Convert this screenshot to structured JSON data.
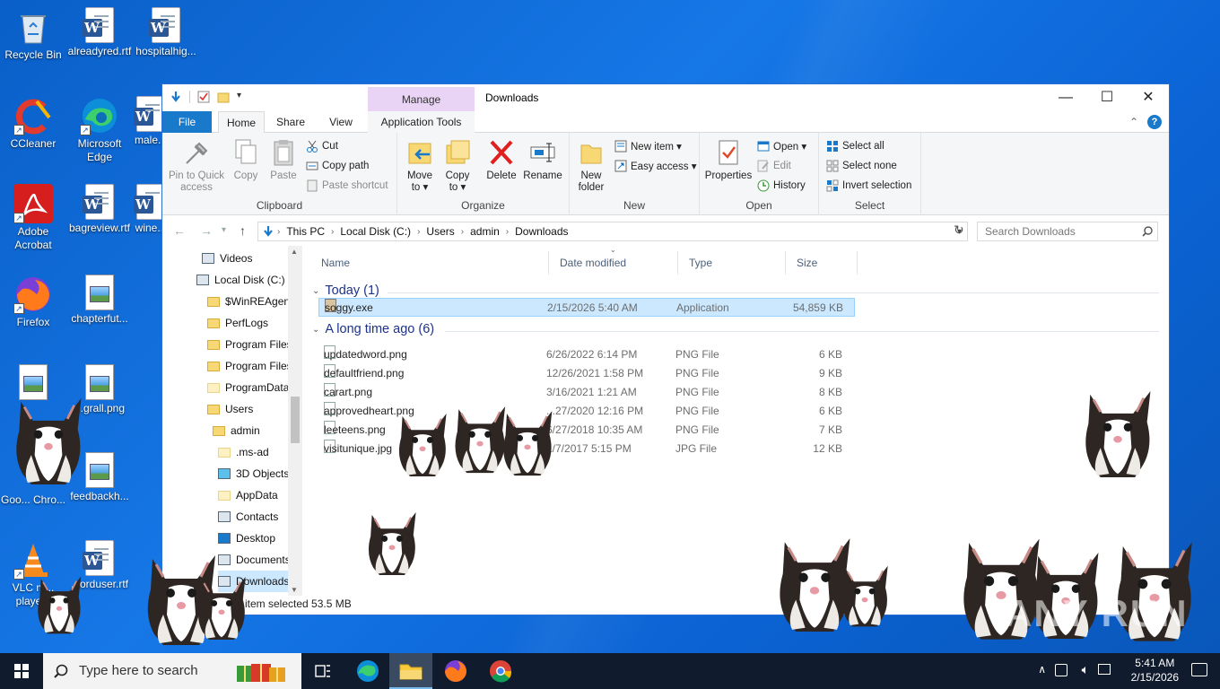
{
  "desktop": {
    "icons": [
      {
        "label": "Recycle Bin",
        "icon": "recycle-bin-icon"
      },
      {
        "label": "alreadyred.rtf",
        "icon": "word-document-icon"
      },
      {
        "label": "hospitalhig...",
        "icon": "word-document-icon"
      },
      {
        "label": "CCleaner",
        "icon": "ccleaner-icon"
      },
      {
        "label": "Microsoft Edge",
        "icon": "edge-icon"
      },
      {
        "label": "male...",
        "icon": "word-document-icon"
      },
      {
        "label": "Adobe Acrobat",
        "icon": "acrobat-icon"
      },
      {
        "label": "bagreview.rtf",
        "icon": "word-document-icon"
      },
      {
        "label": "wine...",
        "icon": "word-document-icon"
      },
      {
        "label": "Firefox",
        "icon": "firefox-icon"
      },
      {
        "label": "chapterfut...",
        "icon": "image-file-icon"
      },
      {
        "label": "...grall.png",
        "icon": "image-file-icon"
      },
      {
        "label": "Goo... Chro...",
        "icon": "chrome-icon"
      },
      {
        "label": "feedbackh...",
        "icon": "image-file-icon"
      },
      {
        "label": "VLC m... playe...",
        "icon": "vlc-icon"
      },
      {
        "label": "...orduser.rtf",
        "icon": "word-document-icon"
      }
    ]
  },
  "window": {
    "title": "Downloads",
    "manage_label": "Manage",
    "controls": {
      "minimize": "—",
      "maximize": "☐",
      "close": "✕"
    },
    "tabs": {
      "file": "File",
      "home": "Home",
      "share": "Share",
      "view": "View",
      "app_tools": "Application Tools"
    },
    "ribbon": {
      "clipboard": {
        "label": "Clipboard",
        "pin": "Pin to Quick access",
        "copy": "Copy",
        "paste": "Paste",
        "cut": "Cut",
        "copy_path": "Copy path",
        "paste_shortcut": "Paste shortcut"
      },
      "organize": {
        "label": "Organize",
        "move_to": "Move to ▾",
        "copy_to": "Copy to ▾",
        "delete": "Delete",
        "rename": "Rename"
      },
      "new": {
        "label": "New",
        "new_folder": "New folder",
        "new_item": "New item ▾",
        "easy_access": "Easy access ▾"
      },
      "open": {
        "label": "Open",
        "properties": "Properties",
        "open": "Open ▾",
        "edit": "Edit",
        "history": "History"
      },
      "select": {
        "label": "Select",
        "select_all": "Select all",
        "select_none": "Select none",
        "invert": "Invert selection"
      }
    },
    "address": {
      "crumbs": [
        "This PC",
        "Local Disk (C:)",
        "Users",
        "admin",
        "Downloads"
      ],
      "search_placeholder": "Search Downloads"
    },
    "nav": {
      "items": [
        {
          "label": "Videos",
          "indent": 1
        },
        {
          "label": "Local Disk (C:)",
          "indent": 0
        },
        {
          "label": "$WinREAgent",
          "indent": 2
        },
        {
          "label": "PerfLogs",
          "indent": 2
        },
        {
          "label": "Program Files",
          "indent": 2
        },
        {
          "label": "Program Files",
          "indent": 2
        },
        {
          "label": "ProgramData",
          "indent": 2
        },
        {
          "label": "Users",
          "indent": 2
        },
        {
          "label": "admin",
          "indent": 3
        },
        {
          "label": ".ms-ad",
          "indent": 4
        },
        {
          "label": "3D Objects",
          "indent": 4
        },
        {
          "label": "AppData",
          "indent": 4
        },
        {
          "label": "Contacts",
          "indent": 4
        },
        {
          "label": "Desktop",
          "indent": 4
        },
        {
          "label": "Documents",
          "indent": 4
        },
        {
          "label": "Downloads",
          "indent": 4
        }
      ]
    },
    "columns": {
      "name": "Name",
      "modified": "Date modified",
      "type": "Type",
      "size": "Size"
    },
    "groups": [
      {
        "header": "Today (1)",
        "files": [
          {
            "name": "soggy.exe",
            "modified": "2/15/2026 5:40 AM",
            "type": "Application",
            "size": "54,859 KB",
            "selected": true
          }
        ]
      },
      {
        "header": "A long time ago (6)",
        "files": [
          {
            "name": "updatedword.png",
            "modified": "6/26/2022 6:14 PM",
            "type": "PNG File",
            "size": "6 KB"
          },
          {
            "name": "defaultfriend.png",
            "modified": "12/26/2021 1:58 PM",
            "type": "PNG File",
            "size": "9 KB"
          },
          {
            "name": "carart.png",
            "modified": "3/16/2021 1:21 AM",
            "type": "PNG File",
            "size": "8 KB"
          },
          {
            "name": "approvedheart.png",
            "modified": "...27/2020 12:16 PM",
            "type": "PNG File",
            "size": "6 KB"
          },
          {
            "name": "leeteens.png",
            "modified": "6/27/2018 10:35 AM",
            "type": "PNG File",
            "size": "7 KB"
          },
          {
            "name": "visitunique.jpg",
            "modified": "1/7/2017 5:15 PM",
            "type": "JPG File",
            "size": "12 KB"
          }
        ]
      }
    ],
    "status": "1 item selected  53.5 MB"
  },
  "taskbar": {
    "search_placeholder": "Type here to search",
    "apps": [
      "task-view-icon",
      "edge-icon",
      "file-explorer-icon",
      "firefox-icon",
      "chrome-icon"
    ],
    "time": "5:41 AM",
    "date": "2/15/2026"
  },
  "watermark": "ANY RUN"
}
